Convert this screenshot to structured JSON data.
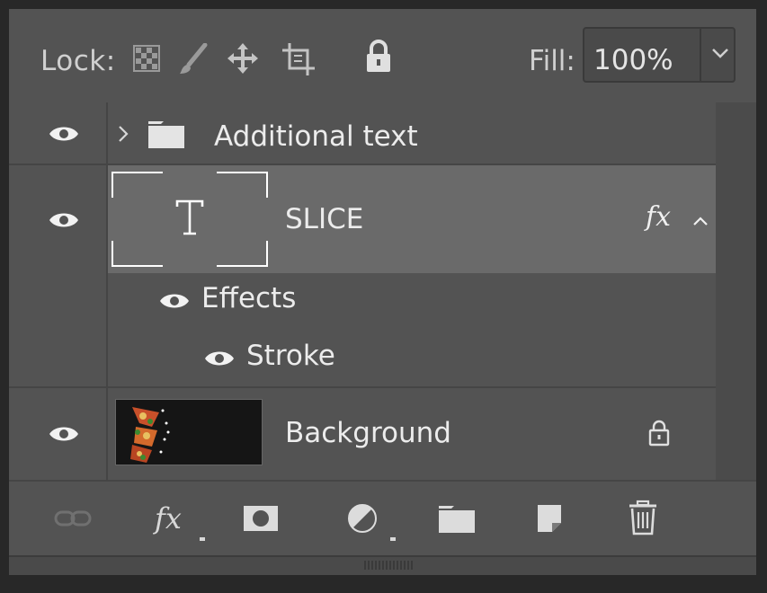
{
  "lock_row": {
    "lock_label": "Lock:",
    "lock_icons": [
      "lock-transparent-pixels-icon",
      "lock-image-pixels-icon",
      "lock-position-icon",
      "lock-artboards-icon",
      "lock-all-icon"
    ],
    "fill_label": "Fill:",
    "fill_value": "100%"
  },
  "layers": [
    {
      "name": "Additional text",
      "kind": "group",
      "visible": true,
      "collapsed": true
    },
    {
      "name": "SLICE",
      "kind": "text",
      "visible": true,
      "selected": true,
      "fx_label": "fx",
      "effects_expanded": true
    },
    {
      "name": "Effects",
      "kind": "effects",
      "visible": true
    },
    {
      "name": "Stroke",
      "kind": "effect",
      "visible": true
    },
    {
      "name": "Background",
      "kind": "image",
      "visible": true,
      "locked": true
    }
  ],
  "toolbar": {
    "fx_label": "fx",
    "icons": [
      "link-layers-icon",
      "add-layer-style-icon",
      "add-mask-icon",
      "new-adjustment-layer-icon",
      "new-group-icon",
      "new-layer-icon",
      "delete-layer-icon"
    ]
  },
  "colors": {
    "panel_bg": "#535353",
    "selected_row": "#6a6a6a",
    "text": "#ececec"
  }
}
